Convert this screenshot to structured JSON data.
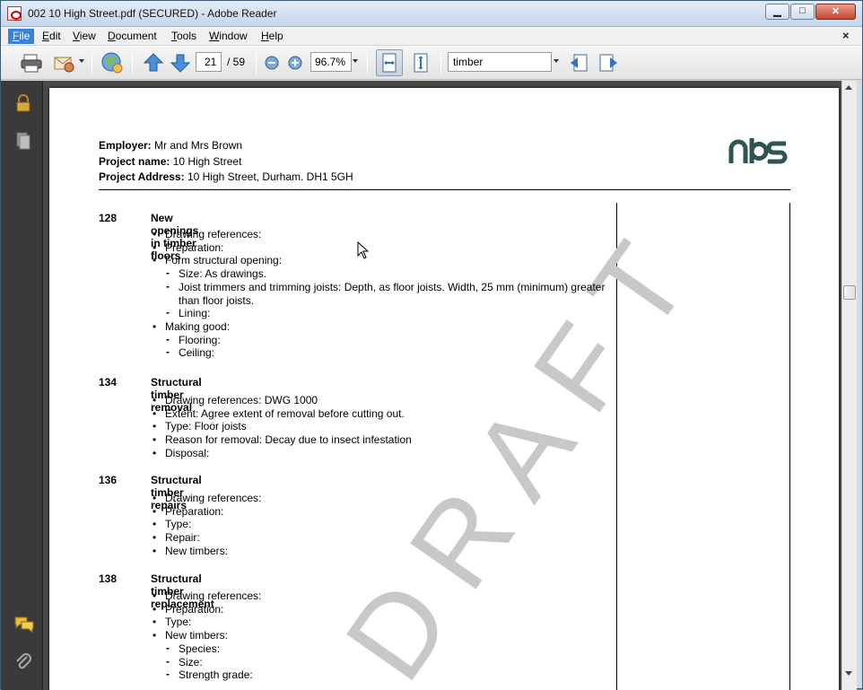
{
  "window": {
    "title": "002 10 High Street.pdf (SECURED) - Adobe Reader"
  },
  "menu": {
    "items": [
      {
        "label": "File",
        "accel": "F",
        "rest": "ile"
      },
      {
        "label": "Edit",
        "accel": "E",
        "rest": "dit"
      },
      {
        "label": "View",
        "accel": "V",
        "rest": "iew"
      },
      {
        "label": "Document",
        "accel": "D",
        "rest": "ocument"
      },
      {
        "label": "Tools",
        "accel": "T",
        "rest": "ools"
      },
      {
        "label": "Window",
        "accel": "W",
        "rest": "indow"
      },
      {
        "label": "Help",
        "accel": "H",
        "rest": "elp"
      }
    ],
    "close_glyph": "×"
  },
  "toolbar": {
    "current_page": "21",
    "total_pages": "/ 59",
    "zoom": "96.7%",
    "find_text": "timber"
  },
  "document": {
    "employer_label": "Employer:",
    "employer_value": "Mr and Mrs Brown",
    "project_name_label": "Project name:",
    "project_name_value": "10 High Street",
    "project_address_label": "Project Address:",
    "project_address_value": "10 High Street, Durham. DH1 5GH",
    "logo_text": "nbs",
    "watermark": "DRAFT",
    "sections": [
      {
        "number": "128",
        "title": "New openings in timber floors",
        "items": [
          {
            "type": "bullet",
            "text": "Drawing references:"
          },
          {
            "type": "bullet",
            "text": "Preparation:"
          },
          {
            "type": "bullet",
            "text": "Form structural opening:"
          },
          {
            "type": "sub",
            "text": "Size: As drawings."
          },
          {
            "type": "sub",
            "text": "Joist trimmers and trimming joists: Depth, as floor joists. Width, 25 mm (minimum) greater than floor joists."
          },
          {
            "type": "sub",
            "text": "Lining:"
          },
          {
            "type": "bullet",
            "text": "Making good:"
          },
          {
            "type": "sub",
            "text": "Flooring:"
          },
          {
            "type": "sub",
            "text": "Ceiling:"
          }
        ]
      },
      {
        "number": "134",
        "title": "Structural timber removal",
        "items": [
          {
            "type": "bullet",
            "text": "Drawing references: DWG 1000"
          },
          {
            "type": "bullet",
            "text": "Extent: Agree extent of removal before cutting out."
          },
          {
            "type": "bullet",
            "text": "Type: Floor joists"
          },
          {
            "type": "bullet",
            "text": "Reason for removal: Decay due to insect infestation"
          },
          {
            "type": "bullet",
            "text": "Disposal:"
          }
        ]
      },
      {
        "number": "136",
        "title": "Structural timber repairs",
        "items": [
          {
            "type": "bullet",
            "text": "Drawing references:"
          },
          {
            "type": "bullet",
            "text": "Preparation:"
          },
          {
            "type": "bullet",
            "text": "Type:"
          },
          {
            "type": "bullet",
            "text": "Repair:"
          },
          {
            "type": "bullet",
            "text": "New timbers:"
          }
        ]
      },
      {
        "number": "138",
        "title": "Structural timber replacement",
        "items": [
          {
            "type": "bullet",
            "text": "Drawing references:"
          },
          {
            "type": "bullet",
            "text": "Preparation:"
          },
          {
            "type": "bullet",
            "text": "Type:"
          },
          {
            "type": "bullet",
            "text": "New timbers:"
          },
          {
            "type": "sub",
            "text": "Species:"
          },
          {
            "type": "sub",
            "text": "Size:"
          },
          {
            "type": "sub",
            "text": "Strength grade:"
          }
        ]
      }
    ]
  },
  "icons": {
    "print": "printer-icon",
    "email": "email-icon",
    "collab": "collaborate-icon",
    "prev": "arrow-up-icon",
    "next": "arrow-down-icon",
    "zoom_out": "zoom-out-icon",
    "zoom_in": "zoom-in-icon",
    "fit_width": "fit-width-icon",
    "fit_page": "fit-page-icon",
    "find_prev": "find-previous-icon",
    "find_next": "find-next-icon",
    "lock": "lock-icon",
    "pages": "pages-icon",
    "comments": "comments-icon",
    "attachments": "paperclip-icon"
  }
}
